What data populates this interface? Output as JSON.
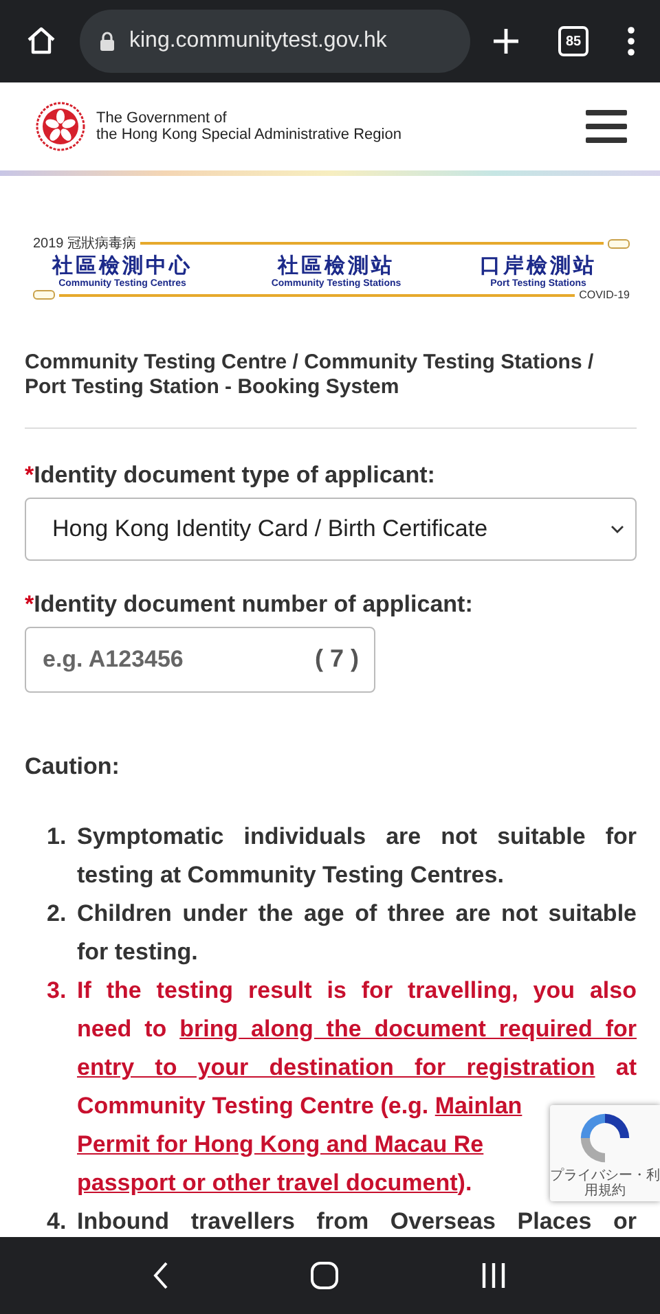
{
  "browser": {
    "url": "king.communitytest.gov.hk",
    "tab_count": "85"
  },
  "header": {
    "title_line_1": "The Government of",
    "title_line_2": "the Hong Kong Special Administrative Region"
  },
  "banner": {
    "top_label": "2019 冠狀病毒病",
    "bottom_label": "COVID-19",
    "sections": [
      {
        "zh": "社區檢測中心",
        "en": "Community Testing Centres"
      },
      {
        "zh": "社區檢測站",
        "en": "Community Testing Stations"
      },
      {
        "zh": "口岸檢測站",
        "en": "Port Testing Stations"
      }
    ]
  },
  "page_title": "Community Testing Centre / Community Testing Stations / Port Testing Station - Booking System",
  "form": {
    "fields": [
      {
        "kind": "select",
        "required_mark": "*",
        "label": "Identity document type of applicant:",
        "value": "Hong Kong Identity Card / Birth Certificate"
      },
      {
        "kind": "text",
        "required_mark": "*",
        "label": "Identity document number of applicant:",
        "placeholder": "e.g. A123456",
        "suffix": "( 7 )"
      }
    ]
  },
  "caution": {
    "heading": "Caution:",
    "items": [
      {
        "number": "1.",
        "kind": "normal",
        "lines": [
          {
            "full": true,
            "segments": [
              {
                "kind": "text",
                "text": "Symptomatic individuals are not suitable for"
              }
            ]
          },
          {
            "full": false,
            "segments": [
              {
                "kind": "text",
                "text": "testing at Community Testing Centres."
              }
            ]
          }
        ]
      },
      {
        "number": "2.",
        "kind": "normal",
        "lines": [
          {
            "full": true,
            "segments": [
              {
                "kind": "text",
                "text": "Children under the age of three are not suitable"
              }
            ]
          },
          {
            "full": false,
            "segments": [
              {
                "kind": "text",
                "text": "for testing."
              }
            ]
          }
        ]
      },
      {
        "number": "3.",
        "kind": "warning",
        "lines": [
          {
            "full": true,
            "segments": [
              {
                "kind": "text",
                "text": "If the testing result is for travelling, you also"
              }
            ]
          },
          {
            "full": true,
            "segments": [
              {
                "kind": "text",
                "text": "need to "
              },
              {
                "kind": "link",
                "text": "bring along the document required for"
              }
            ]
          },
          {
            "full": true,
            "segments": [
              {
                "kind": "link",
                "text": "entry to your destination for registration"
              },
              {
                "kind": "text",
                "text": " at"
              }
            ]
          },
          {
            "full": false,
            "segments": [
              {
                "kind": "text",
                "text": "Community Testing Centre (e.g. "
              },
              {
                "kind": "link",
                "text": "Mainlan"
              }
            ]
          },
          {
            "full": false,
            "segments": [
              {
                "kind": "link",
                "text": "Permit for Hong Kong and Macau Re"
              }
            ]
          },
          {
            "full": false,
            "segments": [
              {
                "kind": "link",
                "text": "passport or other travel document"
              },
              {
                "kind": "text",
                "text": ")."
              }
            ]
          }
        ]
      },
      {
        "number": "4.",
        "kind": "normal",
        "lines": [
          {
            "full": true,
            "segments": [
              {
                "kind": "text",
                "text": "Inbound travellers from Overseas Places or"
              }
            ]
          }
        ]
      }
    ]
  },
  "recaptcha": {
    "links": "プライバシー・利用規約"
  }
}
